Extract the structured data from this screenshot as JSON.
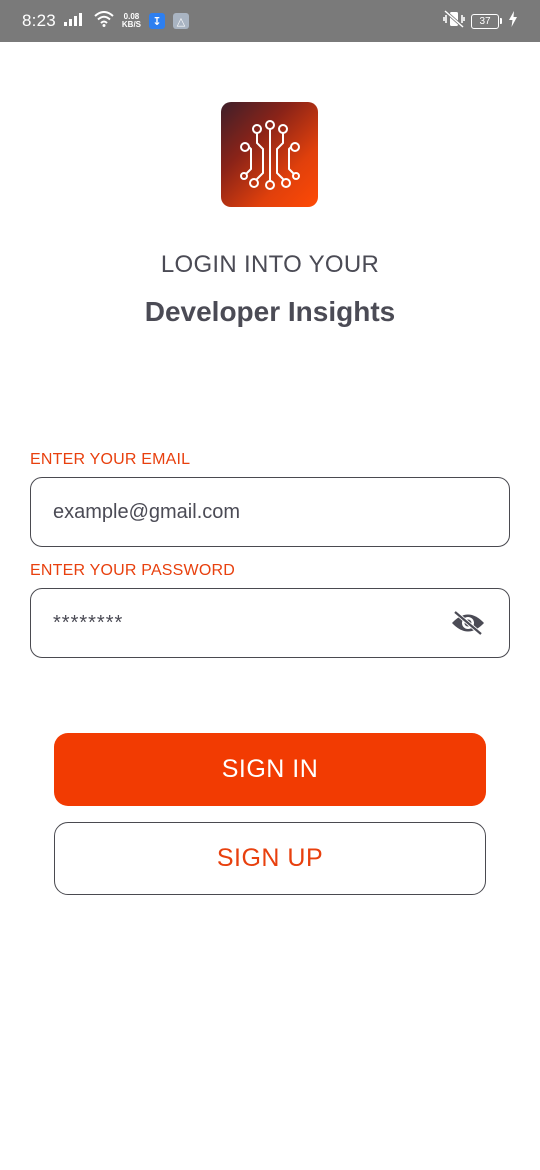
{
  "status_bar": {
    "time": "8:23",
    "net_speed_value": "0.08",
    "net_speed_unit": "KB/S",
    "battery_level": "37"
  },
  "app": {
    "subtitle": "LOGIN INTO YOUR",
    "title": "Developer Insights"
  },
  "form": {
    "email_label": "ENTER YOUR EMAIL",
    "email_value": "example@gmail.com",
    "password_label": "ENTER YOUR PASSWORD",
    "password_value": "********"
  },
  "actions": {
    "sign_in_label": "SIGN IN",
    "sign_up_label": "SIGN UP"
  },
  "colors": {
    "accent": "#f23b02",
    "text": "#4b4b55",
    "status_bar": "#7a7a7a"
  },
  "icons": {
    "logo": "circuit-icon",
    "password_toggle": "eye-off-icon"
  }
}
